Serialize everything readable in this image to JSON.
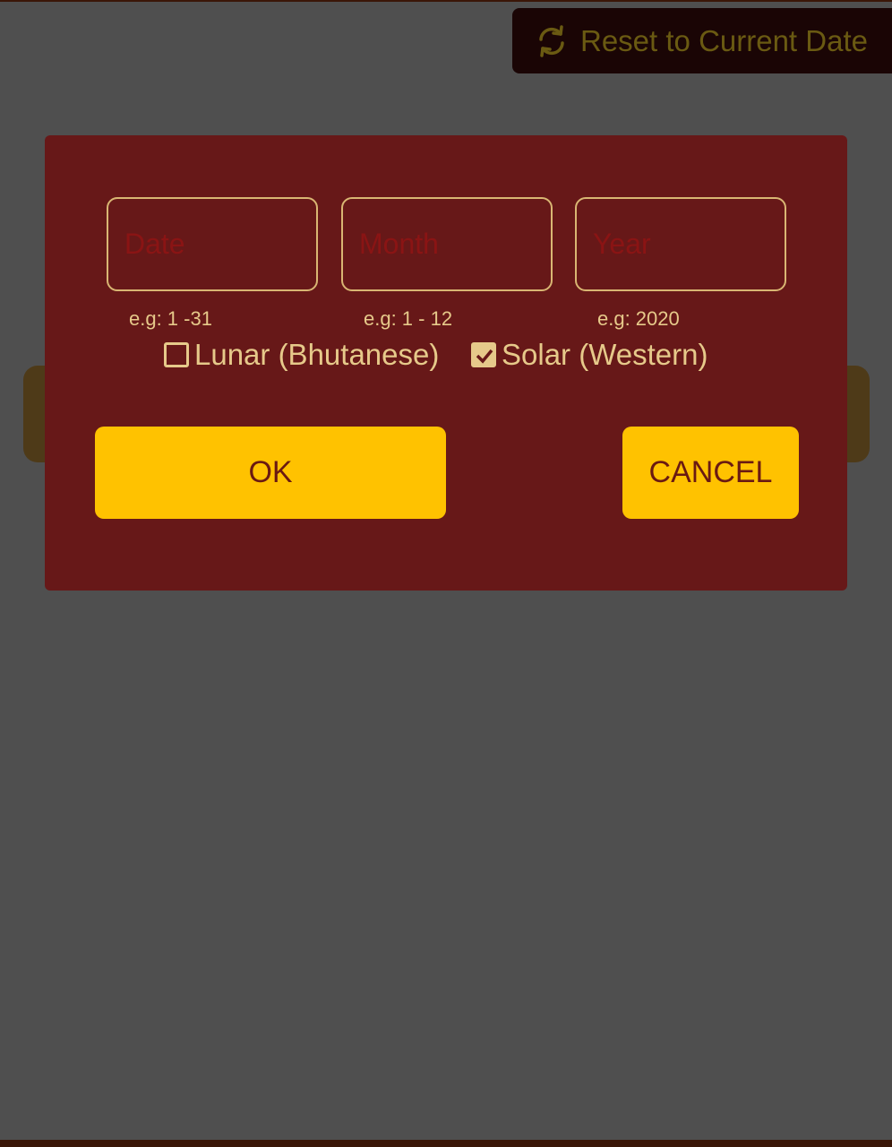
{
  "header": {
    "reset_label": "Reset to Current Date",
    "reset_icon": "refresh-icon"
  },
  "navigation": {
    "prev_icon": "chevron-left-icon",
    "next_icon": "chevron-right-icon"
  },
  "dialog": {
    "fields": {
      "date": {
        "placeholder": "Date",
        "value": "",
        "hint": "e.g: 1 -31"
      },
      "month": {
        "placeholder": "Month",
        "value": "",
        "hint": "e.g: 1 - 12"
      },
      "year": {
        "placeholder": "Year",
        "value": "",
        "hint": "e.g: 2020"
      }
    },
    "calendar_options": {
      "lunar": {
        "label": "Lunar (Bhutanese)",
        "checked": false
      },
      "solar": {
        "label": "Solar (Western)",
        "checked": true
      }
    },
    "ok_label": "OK",
    "cancel_label": "CANCEL"
  },
  "colors": {
    "background": "#4f4f4f",
    "dialog": "#671818",
    "accent": "#ffc200",
    "text_light": "#e6c98a",
    "placeholder": "#8a1414"
  }
}
